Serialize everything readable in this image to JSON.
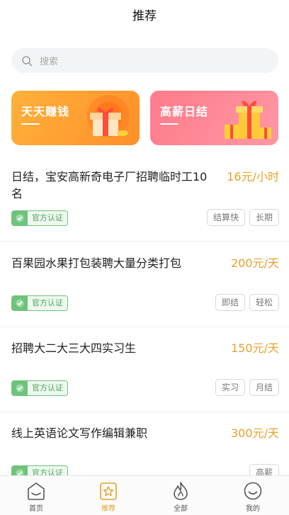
{
  "header": {
    "title": "推荐"
  },
  "search": {
    "placeholder": "搜索"
  },
  "banners": [
    {
      "title": "天天赚钱",
      "color": "#ff9f33"
    },
    {
      "title": "高薪日结",
      "color": "#ff8a97"
    }
  ],
  "jobs": [
    {
      "title": "日结，宝安高新奇电子厂招聘临时工10名",
      "salary": "16元/小时",
      "badge": "官方认证",
      "tags": [
        "结算快",
        "长期"
      ]
    },
    {
      "title": "百果园水果打包装聘大量分类打包",
      "salary": "200元/天",
      "badge": "官方认证",
      "tags": [
        "即结",
        "轻松"
      ]
    },
    {
      "title": "招聘大二大三大四实习生",
      "salary": "150元/天",
      "badge": "官方认证",
      "tags": [
        "实习",
        "月结"
      ]
    },
    {
      "title": "线上英语论文写作编辑兼职",
      "salary": "300元/天",
      "badge": "官方认证",
      "tags": [
        "高薪"
      ]
    }
  ],
  "tabbar": {
    "items": [
      {
        "label": "首页",
        "icon": "home-icon"
      },
      {
        "label": "推荐",
        "icon": "star-icon",
        "active": true
      },
      {
        "label": "全部",
        "icon": "flame-icon"
      },
      {
        "label": "我的",
        "icon": "smile-icon"
      }
    ]
  },
  "colors": {
    "accent": "#e5a12a",
    "verified": "#6dc37a"
  }
}
